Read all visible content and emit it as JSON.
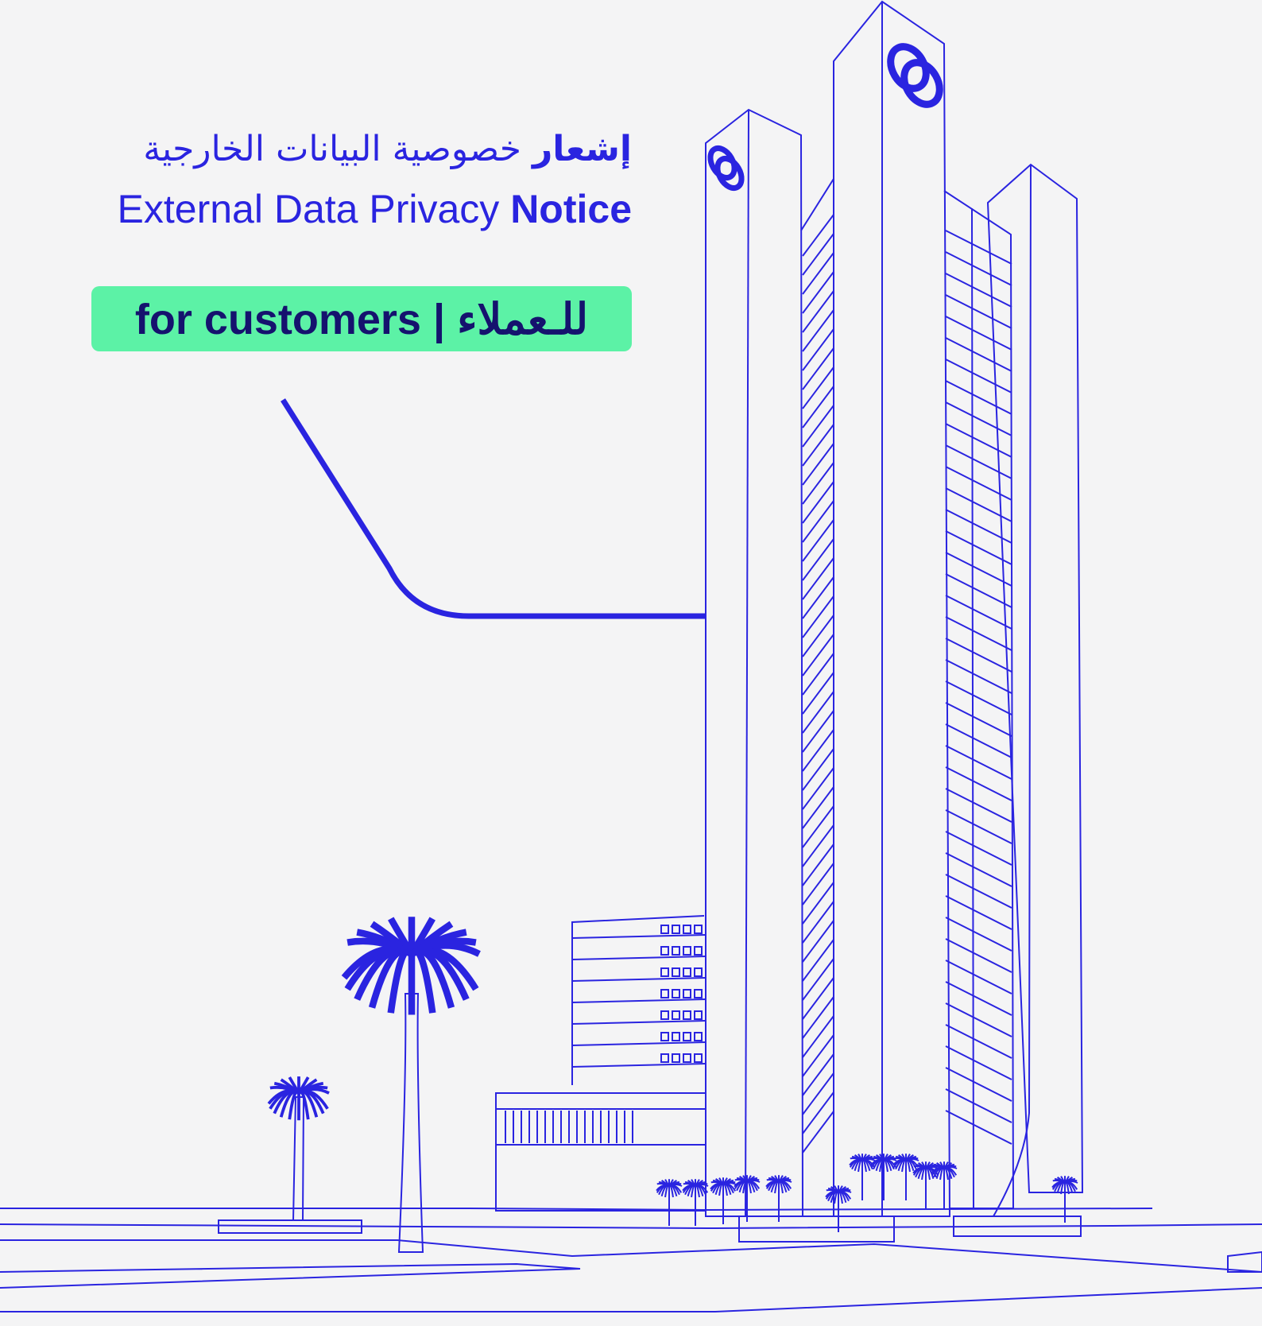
{
  "headline": {
    "arabic_bold": "إشعار",
    "arabic_regular": "خصوصية البيانات الخارجية",
    "english_regular": "External Data Privacy ",
    "english_bold": "Notice"
  },
  "badge": {
    "label": "for customers | للـعملاء"
  },
  "colors": {
    "background": "#f4f4f5",
    "line_blue": "#2a24e0",
    "badge_green": "#5cf2a6",
    "badge_text": "#15126e"
  },
  "illustration": {
    "subject": "line drawing of tower buildings with palm trees",
    "logo_icon": "bank-logo-icon"
  }
}
